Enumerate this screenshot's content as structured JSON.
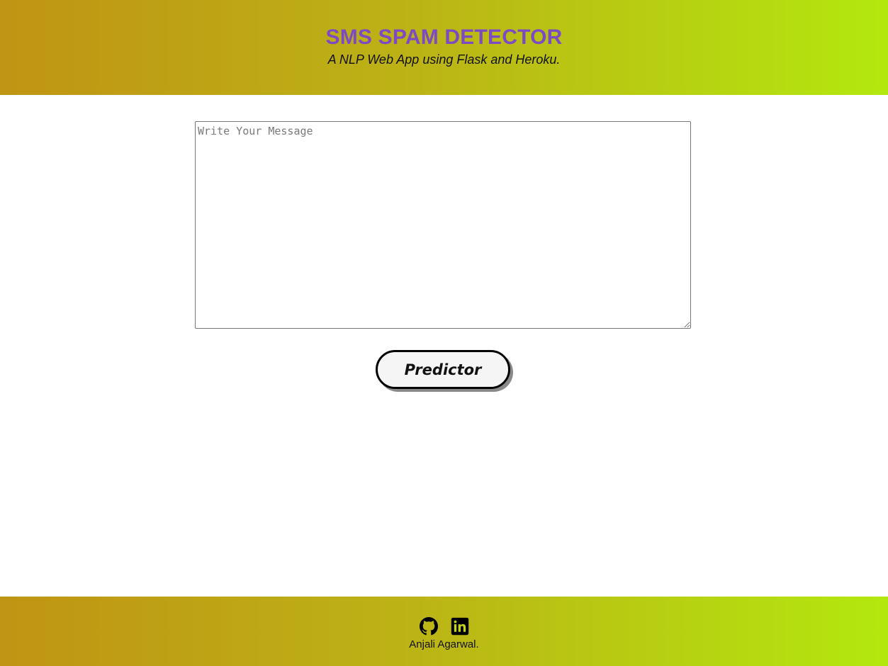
{
  "header": {
    "title": "SMS SPAM DETECTOR",
    "subtitle": "A NLP Web App using Flask and Heroku."
  },
  "form": {
    "message_placeholder": "Write Your Message",
    "message_value": "",
    "submit_label": "Predictor"
  },
  "footer": {
    "links": [
      {
        "icon": "github-icon"
      },
      {
        "icon": "linkedin-icon"
      }
    ],
    "author": "Anjali Agarwal."
  },
  "colors": {
    "title": "#7c4bc4",
    "gradient_start": "#c09414",
    "gradient_end": "#b3e80e"
  }
}
